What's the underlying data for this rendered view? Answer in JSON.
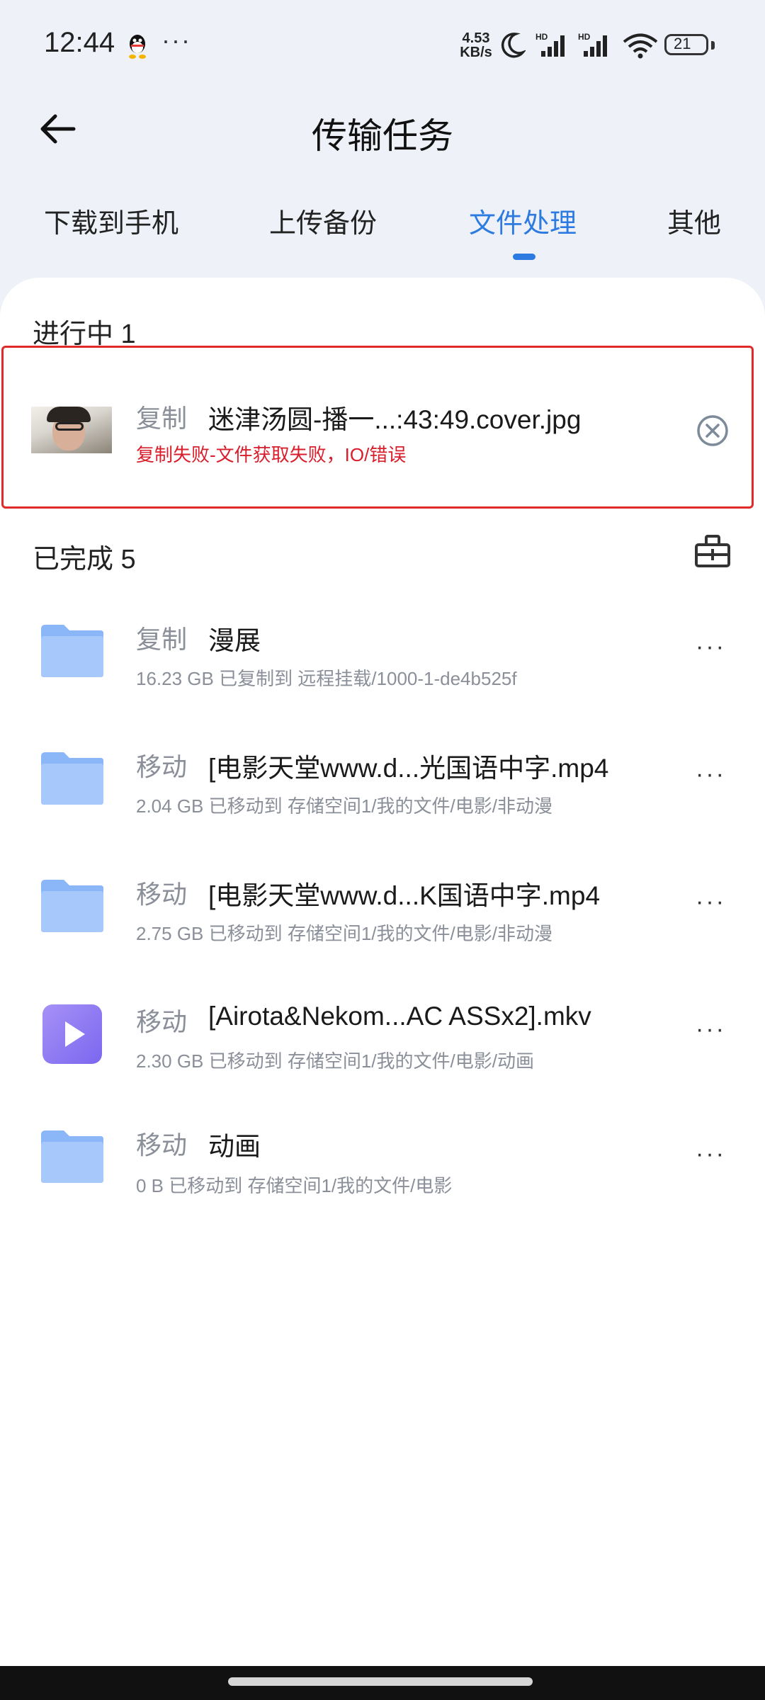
{
  "status": {
    "time": "12:44",
    "net_speed_value": "4.53",
    "net_speed_unit": "KB/s",
    "signal1_label": "HD",
    "signal2_label": "HD",
    "battery": "21"
  },
  "header": {
    "title": "传输任务"
  },
  "tabs": [
    {
      "label": "下载到手机"
    },
    {
      "label": "上传备份"
    },
    {
      "label": "文件处理",
      "active": true
    },
    {
      "label": "其他"
    }
  ],
  "in_progress": {
    "title": "进行中 1",
    "item": {
      "action": "复制",
      "name": "迷津汤圆-播一...:43:49.cover.jpg",
      "error": "复制失败-文件获取失败，IO/错误"
    }
  },
  "completed": {
    "title": "已完成 5",
    "items": [
      {
        "action": "复制",
        "name": "漫展",
        "detail": "16.23 GB 已复制到 远程挂载/1000-1-de4b525f",
        "icon": "folder-icon"
      },
      {
        "action": "移动",
        "name": "[电影天堂www.d...光国语中字.mp4",
        "detail": "2.04 GB 已移动到 存储空间1/我的文件/电影/非动漫",
        "icon": "folder-icon"
      },
      {
        "action": "移动",
        "name": "[电影天堂www.d...K国语中字.mp4",
        "detail": "2.75 GB 已移动到 存储空间1/我的文件/电影/非动漫",
        "icon": "folder-icon"
      },
      {
        "action": "移动",
        "name": "[Airota&Nekom...AC ASSx2].mkv",
        "detail": "2.30 GB 已移动到 存储空间1/我的文件/电影/动画",
        "icon": "video-file-icon"
      },
      {
        "action": "移动",
        "name": "动画",
        "detail": "0 B 已移动到 存储空间1/我的文件/电影",
        "icon": "folder-icon"
      }
    ]
  },
  "colors": {
    "accent": "#2d7be0",
    "error": "#d81e2a",
    "highlight_border": "#e02b2b",
    "folder": "#8bb6f8",
    "video": "#8f7cf3"
  }
}
